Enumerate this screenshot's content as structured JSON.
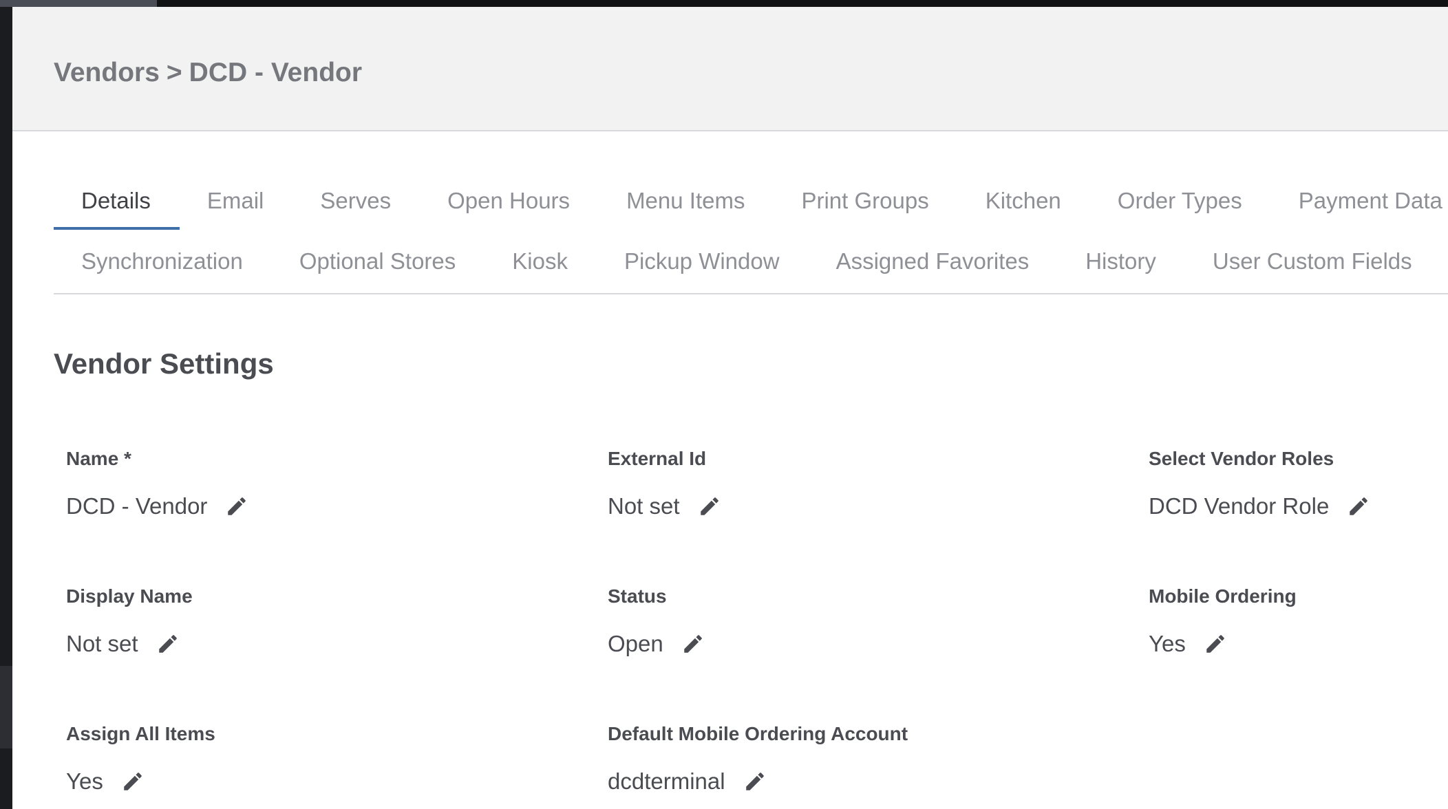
{
  "breadcrumb": {
    "parent": "Vendors",
    "separator": ">",
    "current": "DCD - Vendor"
  },
  "tabs": {
    "row1": [
      "Details",
      "Email",
      "Serves",
      "Open Hours",
      "Menu Items",
      "Print Groups",
      "Kitchen",
      "Order Types",
      "Payment Data"
    ],
    "row2": [
      "Synchronization",
      "Optional Stores",
      "Kiosk",
      "Pickup Window",
      "Assigned Favorites",
      "History",
      "User Custom Fields"
    ],
    "active": "Details"
  },
  "section": {
    "title": "Vendor Settings"
  },
  "fields": {
    "name": {
      "label": "Name *",
      "value": "DCD - Vendor"
    },
    "external_id": {
      "label": "External Id",
      "value": "Not set"
    },
    "vendor_roles": {
      "label": "Select Vendor Roles",
      "value": "DCD Vendor Role"
    },
    "display_name": {
      "label": "Display Name",
      "value": "Not set"
    },
    "status": {
      "label": "Status",
      "value": "Open"
    },
    "mobile_ordering": {
      "label": "Mobile Ordering",
      "value": "Yes"
    },
    "assign_all_items": {
      "label": "Assign All Items",
      "value": "Yes"
    },
    "default_mobile_account": {
      "label": "Default Mobile Ordering Account",
      "value": "dcdterminal"
    }
  },
  "icons": {
    "edit": "pencil-icon"
  },
  "colors": {
    "active_tab_underline": "#3e6fa6",
    "header_bg": "#f2f2f2",
    "text": "#4a4c51",
    "muted_text": "#8e9095"
  }
}
